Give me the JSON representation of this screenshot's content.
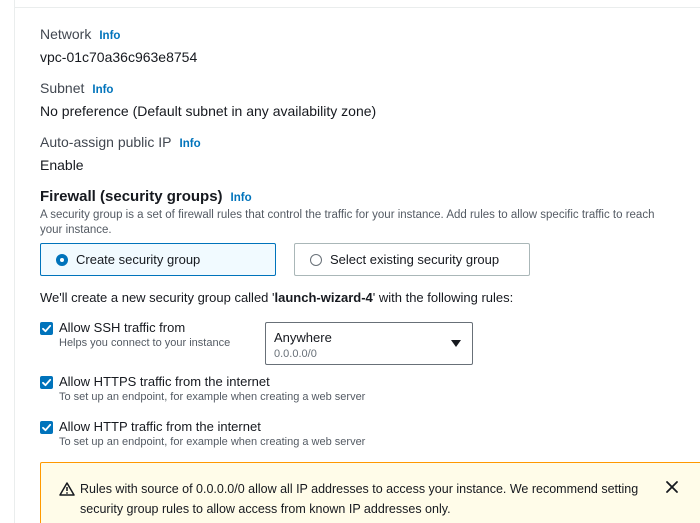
{
  "network": {
    "label": "Network",
    "info": "Info",
    "value": "vpc-01c70a36c963e8754"
  },
  "subnet": {
    "label": "Subnet",
    "info": "Info",
    "value": "No preference (Default subnet in any availability zone)"
  },
  "public_ip": {
    "label": "Auto-assign public IP",
    "info": "Info",
    "value": "Enable"
  },
  "firewall": {
    "title": "Firewall (security groups)",
    "info": "Info",
    "description": "A security group is a set of firewall rules that control the traffic for your instance. Add rules to allow specific traffic to reach your instance.",
    "options": [
      {
        "label": "Create security group",
        "selected": true
      },
      {
        "label": "Select existing security group",
        "selected": false
      }
    ],
    "sentence_before": "We'll create a new security group called '",
    "group_name": "launch-wizard-4",
    "sentence_after": "' with the following rules:",
    "rules": [
      {
        "label": "Allow SSH traffic from",
        "help": "Helps you connect to your instance",
        "checked": true
      },
      {
        "label": "Allow HTTPS traffic from the internet",
        "help": "To set up an endpoint, for example when creating a web server",
        "checked": true
      },
      {
        "label": "Allow HTTP traffic from the internet",
        "help": "To set up an endpoint, for example when creating a web server",
        "checked": true
      }
    ],
    "ssh_source": {
      "value": "Anywhere",
      "sub": "0.0.0.0/0"
    }
  },
  "warning": {
    "text": "Rules with source of 0.0.0.0/0 allow all IP addresses to access your instance. We recommend setting security group rules to allow access from known IP addresses only.",
    "icon": "warning-triangle-icon",
    "close_icon": "close-icon"
  },
  "colors": {
    "accent": "#0073bb",
    "warning_border": "#ff9900",
    "warning_bg": "#fffce9",
    "selected_bg": "#f1faff"
  }
}
